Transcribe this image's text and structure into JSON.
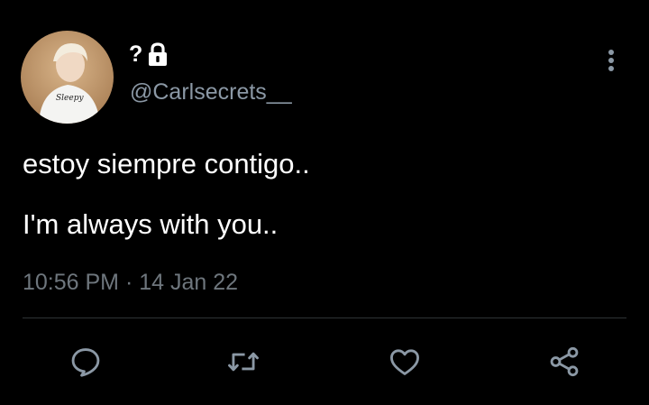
{
  "user": {
    "display_name": "?",
    "handle": "@Carlsecrets__",
    "avatar_text": "Sleepy",
    "protected_icon": "lock-icon"
  },
  "tweet": {
    "lines": [
      "estoy siempre contigo..",
      "I'm always with you.."
    ],
    "timestamp": "10:56 PM · 14 Jan 22"
  },
  "actions": [
    {
      "name": "reply",
      "icon": "reply-icon"
    },
    {
      "name": "retweet",
      "icon": "retweet-icon"
    },
    {
      "name": "like",
      "icon": "heart-icon"
    },
    {
      "name": "share",
      "icon": "share-icon"
    }
  ],
  "colors": {
    "background": "#000000",
    "text_primary": "#ffffff",
    "text_secondary": "#8b98a5",
    "icon": "#8b98a5",
    "divider": "#2f3336"
  }
}
